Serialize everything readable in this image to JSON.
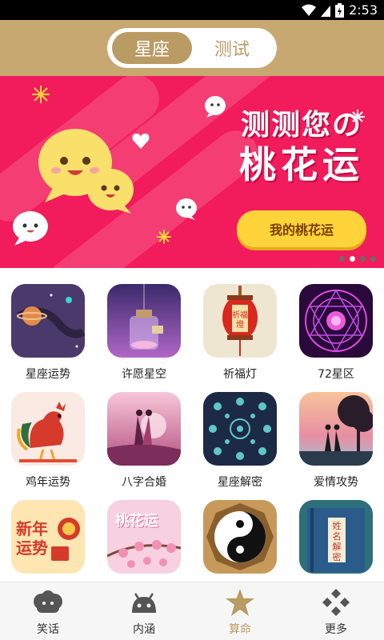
{
  "status_bar": {
    "time": "2:53"
  },
  "header": {
    "tabs": [
      {
        "label": "星座",
        "active": true
      },
      {
        "label": "测试",
        "active": false
      }
    ]
  },
  "banner": {
    "headline_line1": "测测您の",
    "headline_line2": "桃花运",
    "button_label": "我的桃花运",
    "pages": 4,
    "current_page": 2
  },
  "grid": {
    "items": [
      {
        "label": "星座运势",
        "icon": "planet-orbit-icon"
      },
      {
        "label": "许愿星空",
        "icon": "wish-bottle-icon"
      },
      {
        "label": "祈福灯",
        "icon": "lantern-icon"
      },
      {
        "label": "72星区",
        "icon": "zodiac-circle-icon"
      },
      {
        "label": "鸡年运势",
        "icon": "rooster-icon"
      },
      {
        "label": "八字合婚",
        "icon": "couple-icon"
      },
      {
        "label": "星座解密",
        "icon": "zodiac-signs-icon"
      },
      {
        "label": "爱情攻势",
        "icon": "love-tree-icon"
      },
      {
        "label": "",
        "icon": "new-year-fortune-icon",
        "tile_text": "新年运势"
      },
      {
        "label": "",
        "icon": "peach-blossom-icon",
        "tile_text": "桃花运"
      },
      {
        "label": "",
        "icon": "yin-yang-icon"
      },
      {
        "label": "",
        "icon": "name-book-icon",
        "tile_text": "姓名解密"
      }
    ]
  },
  "bottom_nav": {
    "items": [
      {
        "label": "笑话",
        "icon": "cloud-face-icon",
        "active": false
      },
      {
        "label": "内涵",
        "icon": "android-icon",
        "active": false
      },
      {
        "label": "算命",
        "icon": "star-icon",
        "active": true
      },
      {
        "label": "更多",
        "icon": "diamond-grid-icon",
        "active": false
      }
    ]
  },
  "colors": {
    "header": "#c8a871",
    "tab_active": "#b99b63",
    "banner": "#f21b5c",
    "banner_button": "#ffd33a",
    "nav_active": "#b99b63"
  }
}
